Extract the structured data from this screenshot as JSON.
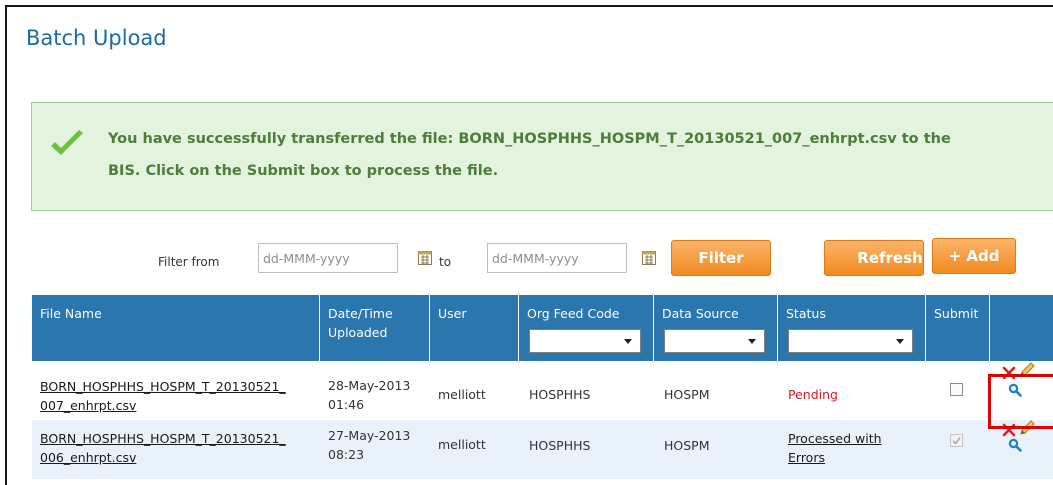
{
  "page": {
    "title": "Batch Upload"
  },
  "success": {
    "line1": "You have successfully transferred the file: BORN_HOSPHHS_HOSPM_T_20130521_007_enhrpt.csv to the",
    "line2": "BIS. Click on the Submit box to process the file."
  },
  "filter": {
    "from_label": "Filter from",
    "from_placeholder": "dd-MMM-yyyy",
    "to_label": "to",
    "to_placeholder": "dd-MMM-yyyy",
    "filter_button": "Filter",
    "refresh_button": "Refresh",
    "add_button": "+ Add"
  },
  "table": {
    "columns": [
      "File Name",
      "Date/Time Uploaded",
      "User",
      "Org Feed Code",
      "Data Source",
      "Status",
      "Submit"
    ],
    "rows": [
      {
        "file_line1": "BORN_HOSPHHS_HOSPM_T_20130521_",
        "file_line2": "007_enhrpt.csv",
        "date": "28-May-2013",
        "time": "01:46",
        "user": "melliott",
        "org": "HOSPHHS",
        "source": "HOSPM",
        "status": "Pending",
        "status_color": "#e0171c",
        "submit_checked": false,
        "submit_enabled": true
      },
      {
        "file_line1": "BORN_HOSPHHS_HOSPM_T_20130521_",
        "file_line2": "006_enhrpt.csv",
        "date": "27-May-2013",
        "time": "08:23",
        "user": "melliott",
        "org": "HOSPHHS",
        "source": "HOSPM",
        "status_line1": "Processed with",
        "status_line2": "Errors",
        "submit_checked": true,
        "submit_enabled": false
      }
    ]
  },
  "colors": {
    "title": "#1d6aa2",
    "header_bg": "#2a76ad",
    "row_alt_bg": "#e9f2fb",
    "orange": "#f28a1f",
    "success_bg": "#e3f3dd",
    "success_text": "#4f7b3b",
    "highlight": "#e00000"
  },
  "icons": [
    "checkmark-icon",
    "calendar-icon",
    "delete-icon",
    "edit-icon",
    "view-icon",
    "dropdown-arrow-icon"
  ]
}
